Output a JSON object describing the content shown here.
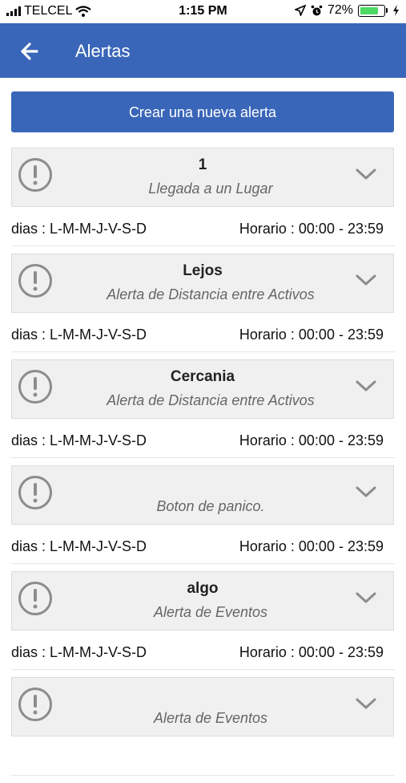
{
  "status_bar": {
    "carrier": "TELCEL",
    "time": "1:15 PM",
    "battery": "72%"
  },
  "app_bar": {
    "title": "Alertas",
    "back_icon": "arrow-left-icon"
  },
  "create_button": {
    "label": "Crear una nueva alerta"
  },
  "alerts": [
    {
      "title": "1",
      "type": "Llegada a un Lugar",
      "dias": "dias : L-M-M-J-V-S-D",
      "horario": "Horario : 00:00 - 23:59"
    },
    {
      "title": "Lejos",
      "type": "Alerta de Distancia entre Activos",
      "dias": "dias : L-M-M-J-V-S-D",
      "horario": "Horario : 00:00 - 23:59"
    },
    {
      "title": "Cercania",
      "type": "Alerta de Distancia entre Activos",
      "dias": "dias : L-M-M-J-V-S-D",
      "horario": "Horario : 00:00 - 23:59"
    },
    {
      "title": "",
      "type": "Boton de panico.",
      "dias": "dias : L-M-M-J-V-S-D",
      "horario": "Horario : 00:00 - 23:59"
    },
    {
      "title": "algo",
      "type": "Alerta de Eventos",
      "dias": "dias : L-M-M-J-V-S-D",
      "horario": "Horario : 00:00 - 23:59"
    },
    {
      "title": "",
      "type": "Alerta de Eventos",
      "dias": "",
      "horario": ""
    }
  ],
  "colors": {
    "primary": "#3a66b9",
    "card_bg": "#f0f0f0",
    "icon_gray": "#8c8c8c"
  },
  "icons": {
    "alert": "exclamation-circle-icon",
    "expand": "chevron-down-icon"
  }
}
